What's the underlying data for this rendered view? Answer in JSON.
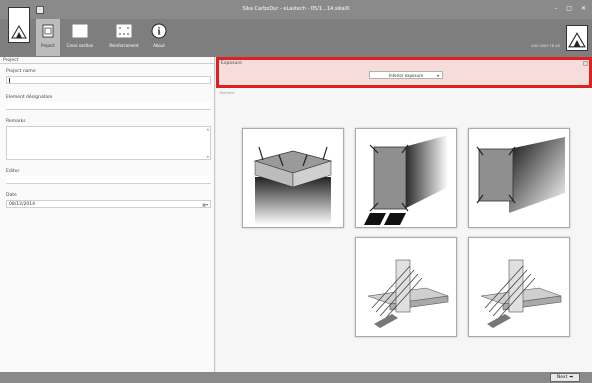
{
  "window": {
    "title": "Sika CarboDur - eLastech - 05/1...14.sikaXl",
    "min": "–",
    "max": "□",
    "close": "✕"
  },
  "ribbon": {
    "tabs": [
      {
        "label": "Project",
        "icon": "project-icon"
      },
      {
        "label": "Cross section",
        "icon": "cross-section-icon"
      },
      {
        "label": "Reinforcement",
        "icon": "reinforcement-icon"
      },
      {
        "label": "About",
        "icon": "info-icon"
      }
    ],
    "version": "XXX 0000 TB.XX"
  },
  "project": {
    "header": "Project",
    "project_name_label": "Project name",
    "project_name_value": "",
    "element_label": "Element désignation",
    "element_value": "",
    "remarks_label": "Remarks",
    "remarks_value": "",
    "editor_label": "Editor",
    "editor_value": "",
    "date_label": "Date",
    "date_value": "08/12/2014"
  },
  "exposure": {
    "header": "Exposure",
    "selected": "Interior exposure",
    "sub_label": "Element"
  },
  "footer": {
    "next_label": "Next"
  }
}
